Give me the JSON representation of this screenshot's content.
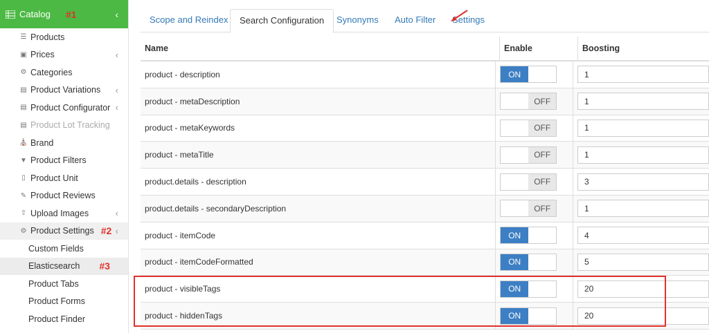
{
  "sidebar": {
    "header": {
      "title": "Catalog",
      "marker": "#1",
      "icon": "grid-icon"
    },
    "items": [
      {
        "label": "Products",
        "icon": "list-icon",
        "chevron": false
      },
      {
        "label": "Prices",
        "icon": "price-tag-icon",
        "chevron": true
      },
      {
        "label": "Categories",
        "icon": "sitemap-icon",
        "chevron": false
      },
      {
        "label": "Product Variations",
        "icon": "variations-icon",
        "chevron": true
      },
      {
        "label": "Product Configurator",
        "icon": "configurator-icon",
        "chevron": true
      },
      {
        "label": "Product Lot Tracking",
        "icon": "lot-tracking-icon",
        "chevron": false
      },
      {
        "label": "Brand",
        "icon": "bank-icon",
        "chevron": false
      },
      {
        "label": "Product Filters",
        "icon": "filter-icon",
        "chevron": false
      },
      {
        "label": "Product Unit",
        "icon": "unit-icon",
        "chevron": false
      },
      {
        "label": "Product Reviews",
        "icon": "edit-icon",
        "chevron": false
      },
      {
        "label": "Upload Images",
        "icon": "upload-icon",
        "chevron": true
      },
      {
        "label": "Product Settings",
        "icon": "gear-icon",
        "chevron": true,
        "marker": "#2"
      }
    ],
    "subitems": [
      {
        "label": "Custom Fields"
      },
      {
        "label": "Elasticsearch",
        "marker": "#3"
      },
      {
        "label": "Product Tabs"
      },
      {
        "label": "Product Forms"
      },
      {
        "label": "Product Finder"
      }
    ]
  },
  "tabs": [
    "Scope and Reindex",
    "Search Configuration",
    "Synonyms",
    "Auto Filter",
    "Settings"
  ],
  "active_tab": "Search Configuration",
  "table": {
    "headers": {
      "name": "Name",
      "enable": "Enable",
      "boosting": "Boosting"
    },
    "toggle_labels": {
      "on": "ON",
      "off": "OFF"
    },
    "rows": [
      {
        "name": "product - description",
        "enabled": true,
        "boosting": "1"
      },
      {
        "name": "product - metaDescription",
        "enabled": false,
        "boosting": "1"
      },
      {
        "name": "product - metaKeywords",
        "enabled": false,
        "boosting": "1"
      },
      {
        "name": "product - metaTitle",
        "enabled": false,
        "boosting": "1"
      },
      {
        "name": "product.details - description",
        "enabled": false,
        "boosting": "3"
      },
      {
        "name": "product.details - secondaryDescription",
        "enabled": false,
        "boosting": "1"
      },
      {
        "name": "product - itemCode",
        "enabled": true,
        "boosting": "4"
      },
      {
        "name": "product - itemCodeFormatted",
        "enabled": true,
        "boosting": "5"
      },
      {
        "name": "product - visibleTags",
        "enabled": true,
        "boosting": "20"
      },
      {
        "name": "product - hiddenTags",
        "enabled": true,
        "boosting": "20"
      }
    ]
  },
  "colors": {
    "header_green": "#4cb944",
    "on_blue": "#3d7fc4",
    "annotation_red": "#e0312b",
    "link_blue": "#337ab7"
  }
}
